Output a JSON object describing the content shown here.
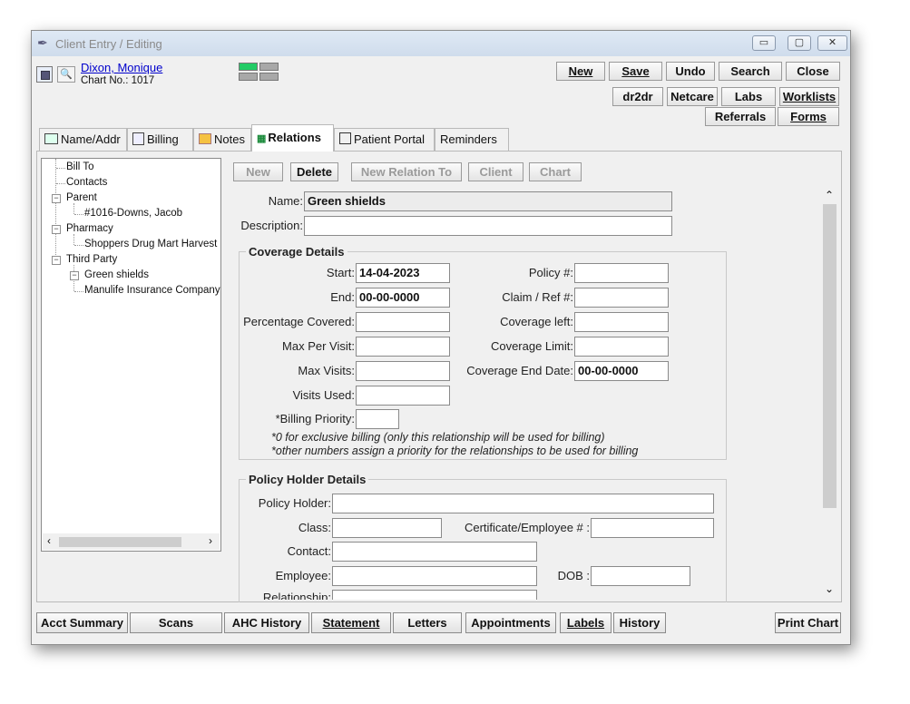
{
  "window": {
    "title": "Client Entry / Editing",
    "controls": [
      "▭",
      "▢",
      "✕"
    ]
  },
  "patient": {
    "name": "Dixon, Monique",
    "chart_no": "Chart No.: 1017"
  },
  "toolbar": {
    "row1": [
      "New",
      "Save",
      "Undo",
      "Search",
      "Close"
    ],
    "row2": [
      "dr2dr",
      "Netcare",
      "Labs",
      "Worklists"
    ],
    "row3": [
      "Referrals",
      "Forms"
    ]
  },
  "tabs": [
    "Name/Addr",
    "Billing",
    "Notes",
    "Relations",
    "Patient Portal",
    "Reminders"
  ],
  "active_tab": "Relations",
  "tree": {
    "items": [
      "Bill To",
      "Contacts",
      "Parent",
      "#1016-Downs, Jacob",
      "Pharmacy",
      "Shoppers Drug Mart Harvest",
      "Third Party",
      "Green shields",
      "Manulife Insurance Company"
    ]
  },
  "actions": [
    "New",
    "Delete",
    "New Relation To",
    "Client",
    "Chart"
  ],
  "form": {
    "name_label": "Name:",
    "name_value": "Green shields",
    "description_label": "Description:",
    "description_value": "",
    "coverage": {
      "title": "Coverage Details",
      "start_label": "Start:",
      "start_value": "14-04-2023",
      "end_label": "End:",
      "end_value": "00-00-0000",
      "pct_label": "Percentage Covered:",
      "max_visit_label": "Max Per Visit:",
      "max_visits_label": "Max Visits:",
      "visits_used_label": "Visits Used:",
      "billing_priority_label": "*Billing Priority:",
      "policy_label": "Policy #:",
      "claim_label": "Claim / Ref #:",
      "coverage_left_label": "Coverage left:",
      "coverage_limit_label": "Coverage Limit:",
      "coverage_end_label": "Coverage End Date:",
      "coverage_end_value": "00-00-0000",
      "note1": "*0 for exclusive billing (only this relationship will be used for billing)",
      "note2": "*other numbers assign a priority for the relationships to be used for billing"
    },
    "policy_holder": {
      "title": "Policy Holder Details",
      "holder_label": "Policy Holder:",
      "class_label": "Class:",
      "cert_label": "Certificate/Employee # :",
      "contact_label": "Contact:",
      "employee_label": "Employee:",
      "dob_label": "DOB :",
      "relationship_label": "Relationship:"
    }
  },
  "bottom_buttons": [
    "Acct Summary",
    "Scans",
    "AHC History",
    "Statement",
    "Letters",
    "Appointments",
    "Labels",
    "History"
  ],
  "print_chart": "Print Chart",
  "colors": {
    "indicator_green": "#22cc66",
    "link": "#0000cc"
  }
}
